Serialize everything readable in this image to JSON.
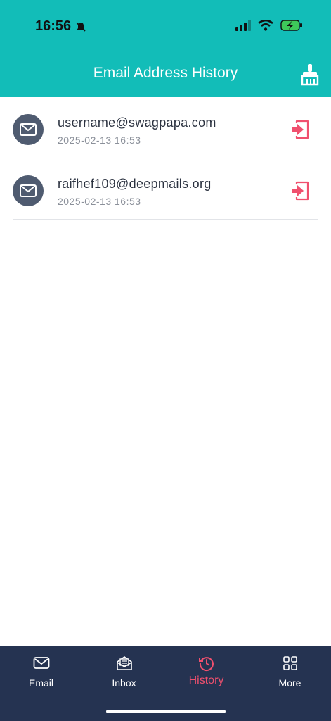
{
  "status": {
    "time": "16:56"
  },
  "header": {
    "title": "Email Address History"
  },
  "history": [
    {
      "email": "username@swagpapa.com",
      "time": "2025-02-13 16:53"
    },
    {
      "email": "raifhef109@deepmails.org",
      "time": "2025-02-13 16:53"
    }
  ],
  "tabs": [
    {
      "label": "Email",
      "icon": "mail-icon"
    },
    {
      "label": "Inbox",
      "icon": "inbox-icon"
    },
    {
      "label": "History",
      "icon": "history-icon"
    },
    {
      "label": "More",
      "icon": "grid-icon"
    }
  ],
  "colors": {
    "header": "#12bdb8",
    "tabbar": "#253351",
    "accent": "#f0506e",
    "avatar": "#4f5b70"
  }
}
